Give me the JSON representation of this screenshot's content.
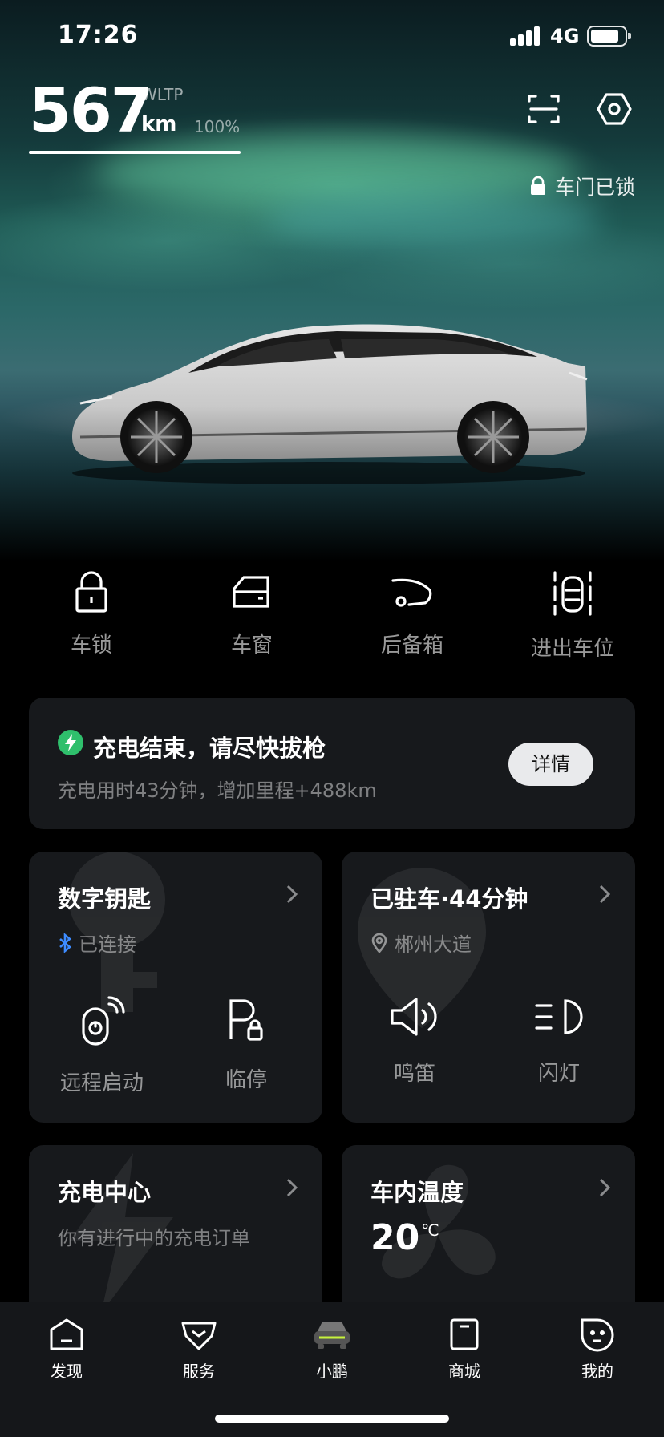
{
  "status_bar": {
    "time": "17:26",
    "network": "4G"
  },
  "range": {
    "value": "567",
    "unit": "km",
    "standard": "WLTP",
    "battery_percent": "100%",
    "battery_level": 1.0
  },
  "lock_status": "车门已锁",
  "quick_actions": [
    {
      "label": "车锁",
      "icon": "lock-icon"
    },
    {
      "label": "车窗",
      "icon": "window-icon"
    },
    {
      "label": "后备箱",
      "icon": "trunk-icon"
    },
    {
      "label": "进出车位",
      "icon": "parking-icon"
    }
  ],
  "charge_notice": {
    "title": "充电结束，请尽快拔枪",
    "subtitle": "充电用时43分钟，增加里程+488km",
    "button": "详情",
    "accent": "#2fbf6c"
  },
  "digital_key": {
    "title": "数字钥匙",
    "status": "已连接",
    "actions": [
      {
        "label": "远程启动"
      },
      {
        "label": "临停"
      }
    ]
  },
  "parking": {
    "title": "已驻车·44分钟",
    "location": "郴州大道",
    "actions": [
      {
        "label": "鸣笛"
      },
      {
        "label": "闪灯"
      }
    ]
  },
  "charging_center": {
    "title": "充电中心",
    "subtitle": "你有进行中的充电订单"
  },
  "cabin_temp": {
    "title": "车内温度",
    "value": "20",
    "unit": "℃"
  },
  "bottom_nav": [
    {
      "label": "发现",
      "icon": "discover-icon"
    },
    {
      "label": "服务",
      "icon": "service-icon"
    },
    {
      "label": "小鹏",
      "icon": "car-icon",
      "active": true
    },
    {
      "label": "商城",
      "icon": "shop-icon"
    },
    {
      "label": "我的",
      "icon": "profile-icon"
    }
  ],
  "colors": {
    "accent_green": "#c6f23c",
    "bluetooth": "#3d8bff",
    "card_bg": "#17191c"
  }
}
